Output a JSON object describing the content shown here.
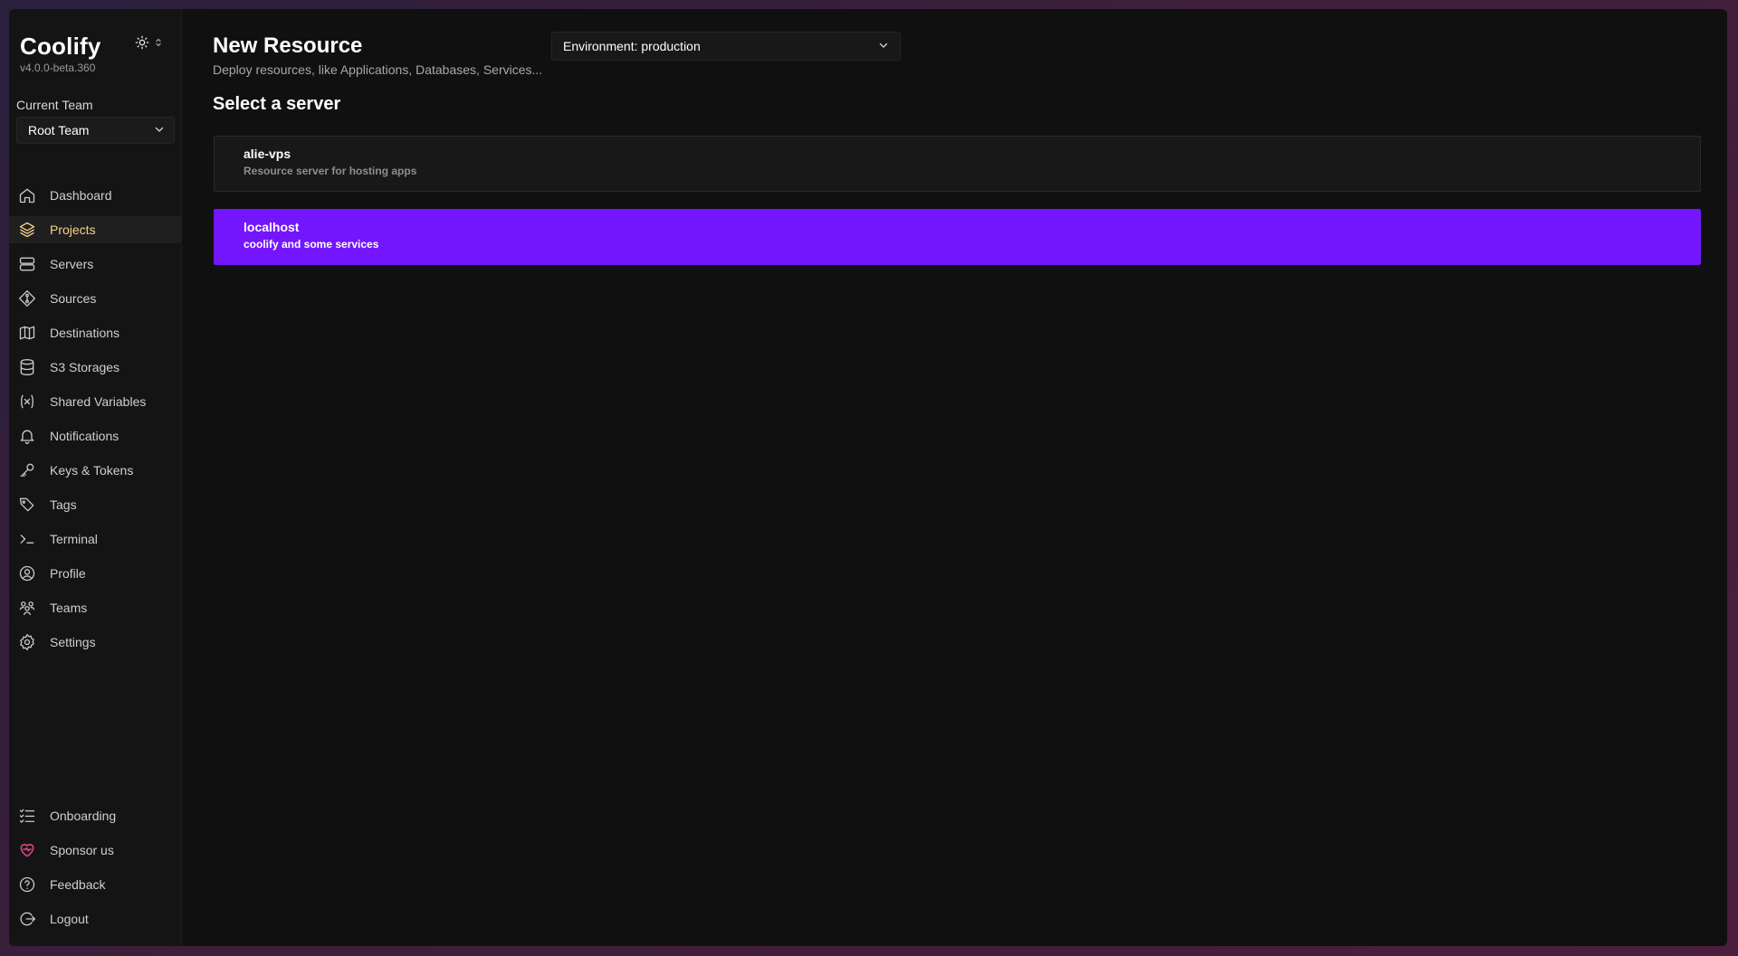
{
  "app": {
    "name": "Coolify",
    "version": "v4.0.0-beta.360"
  },
  "sidebar": {
    "team_label": "Current Team",
    "team_value": "Root Team",
    "items": [
      {
        "label": "Dashboard",
        "icon": "home-icon"
      },
      {
        "label": "Projects",
        "icon": "layers-icon",
        "active": true
      },
      {
        "label": "Servers",
        "icon": "server-icon"
      },
      {
        "label": "Sources",
        "icon": "git-icon"
      },
      {
        "label": "Destinations",
        "icon": "map-icon"
      },
      {
        "label": "S3 Storages",
        "icon": "database-icon"
      },
      {
        "label": "Shared Variables",
        "icon": "variable-icon"
      },
      {
        "label": "Notifications",
        "icon": "bell-icon"
      },
      {
        "label": "Keys & Tokens",
        "icon": "key-icon"
      },
      {
        "label": "Tags",
        "icon": "tags-icon"
      },
      {
        "label": "Terminal",
        "icon": "terminal-icon"
      },
      {
        "label": "Profile",
        "icon": "user-circle-icon"
      },
      {
        "label": "Teams",
        "icon": "users-icon"
      },
      {
        "label": "Settings",
        "icon": "gear-icon"
      }
    ],
    "bottom_items": [
      {
        "label": "Onboarding",
        "icon": "checklist-icon"
      },
      {
        "label": "Sponsor us",
        "icon": "heart-icon"
      },
      {
        "label": "Feedback",
        "icon": "help-icon"
      },
      {
        "label": "Logout",
        "icon": "logout-icon"
      }
    ]
  },
  "main": {
    "title": "New Resource",
    "environment_select": "Environment: production",
    "subtitle": "Deploy resources, like Applications, Databases, Services...",
    "section_title": "Select a server",
    "servers": [
      {
        "name": "alie-vps",
        "description": "Resource server for hosting apps"
      },
      {
        "name": "localhost",
        "description": "coolify and some services"
      }
    ]
  },
  "colors": {
    "accent": "#7316fe",
    "active_nav_text": "#f6d38b",
    "sponsor_heart": "#e8458b"
  }
}
